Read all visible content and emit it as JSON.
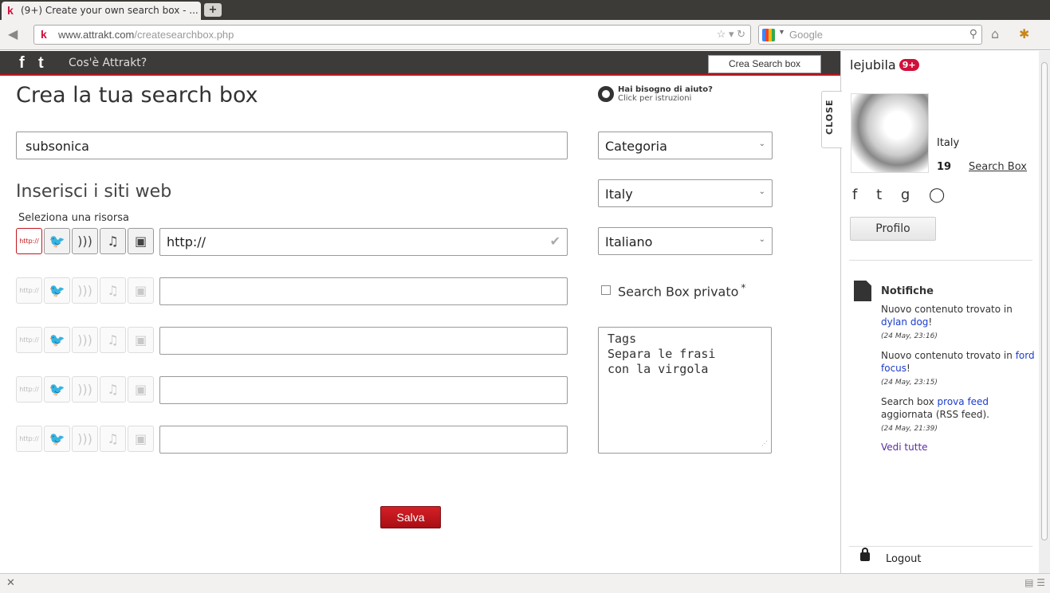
{
  "browser": {
    "tab_title": "(9+) Create your own search box - ...",
    "new_tab_label": "+",
    "url_domain": "www.attrakt.com",
    "url_path": "/createsearchbox.php",
    "search_placeholder": "Google"
  },
  "site": {
    "what_is": "Cos'è Attrakt?",
    "crea_button": "Crea Search box",
    "facebook": "f",
    "twitter": "t"
  },
  "main": {
    "title": "Crea la tua search box",
    "help_title": "Hai bisogno di aiuto?",
    "help_sub": "Click per istruzioni",
    "name_value": "subsonica",
    "sites_heading": "Inserisci i siti web",
    "select_resource": "Seleziona una risorsa",
    "http_label": "http://",
    "first_url": "http://",
    "category_value": "Categoria",
    "country_value": "Italy",
    "language_value": "Italiano",
    "private_label": "Search Box privato",
    "private_star": "*",
    "tags_placeholder": "Tags\nSepara le frasi\ncon la virgola",
    "save_label": "Salva"
  },
  "sidebar": {
    "username": "lejubila",
    "badge": "9+",
    "close_label": "CLOSE",
    "country": "Italy",
    "search_box_count": "19",
    "search_box_link": "Search Box",
    "profile_button": "Profilo",
    "notifications_title": "Notifiche",
    "notifications": [
      {
        "text": "Nuovo contenuto trovato in ",
        "link": "dylan dog",
        "tail": "!",
        "time": "(24 May, 23:16)"
      },
      {
        "text": "Nuovo contenuto trovato in ",
        "link": "ford focus",
        "tail": "!",
        "time": "(24 May, 23:15)"
      },
      {
        "text": "Search box ",
        "link": "prova feed",
        "tail": " aggiornata (RSS feed).",
        "time": "(24 May, 21:39)"
      }
    ],
    "see_all": "Vedi tutte",
    "logout": "Logout"
  }
}
